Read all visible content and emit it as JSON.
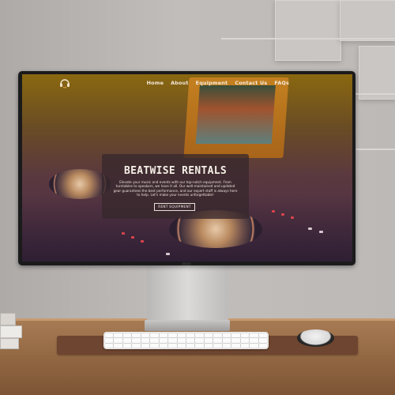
{
  "website": {
    "nav": {
      "logo_icon": "headphones-icon",
      "menu": [
        "Home",
        "About",
        "Equipment",
        "Contact Us",
        "FAQs"
      ]
    },
    "hero": {
      "title": "BEATWISE RENTALS",
      "description": "Elevate your music and events with our top-notch equipment. From turntables to speakers, we have it all. Our well-maintained and updated gear guarantees the best performance, and our expert staff is always here to help. Let's make your events unforgettable!",
      "button_label": "RENT EQUIPMENT"
    }
  },
  "colors": {
    "screen_top": "#8a6810",
    "screen_bottom": "#4b2e47",
    "hero_overlay": "#372832",
    "wood_desk": "#8e6440",
    "desk_pad": "#6e4530"
  },
  "icons": [
    "headphones-icon"
  ]
}
